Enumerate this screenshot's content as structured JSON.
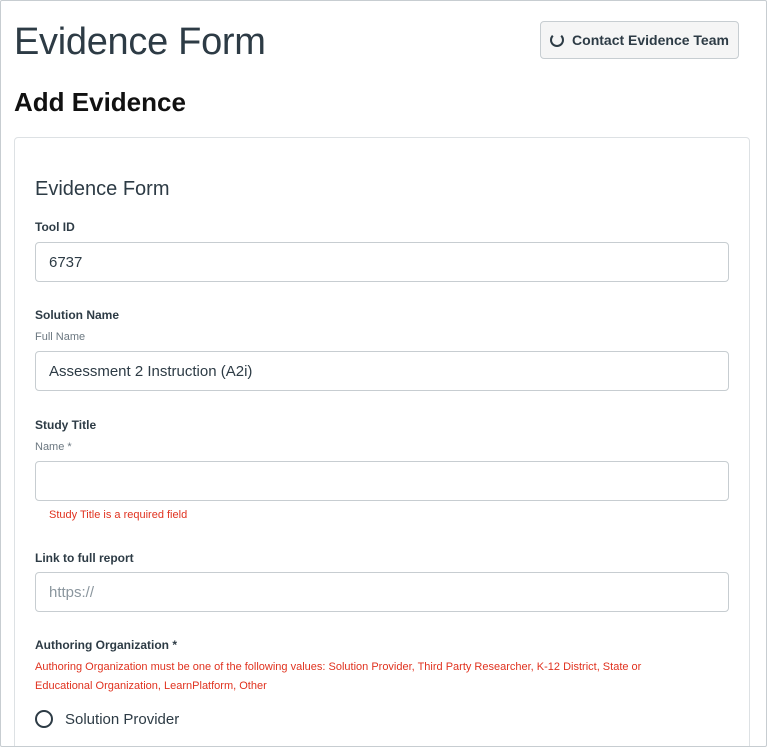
{
  "header": {
    "title": "Evidence Form",
    "subtitle": "Add Evidence",
    "contact_button": "Contact Evidence Team"
  },
  "form": {
    "title": "Evidence Form",
    "tool_id": {
      "label": "Tool ID",
      "value": "6737"
    },
    "solution_name": {
      "label": "Solution Name",
      "sublabel": "Full Name",
      "value": "Assessment 2 Instruction (A2i)"
    },
    "study_title": {
      "label": "Study Title",
      "sublabel": "Name *",
      "value": "",
      "error": "Study Title is a required field"
    },
    "report_link": {
      "label": "Link to full report",
      "placeholder": "https://"
    },
    "authoring_org": {
      "label": "Authoring Organization *",
      "error_line1": "Authoring Organization must be one of the following values: Solution Provider, Third Party Researcher, K-12 District, State or",
      "error_line2": "Educational Organization, LearnPlatform, Other",
      "options": [
        "Solution Provider"
      ]
    }
  },
  "colors": {
    "text": "#2d3b45",
    "error": "#e0321f",
    "border": "#c7cdd1"
  }
}
